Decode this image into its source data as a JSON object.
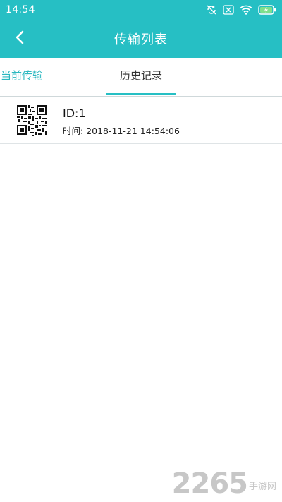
{
  "status_bar": {
    "time": "14:54",
    "icons": [
      "no-sync-icon",
      "sim-blocked-icon",
      "wifi-icon",
      "battery-charging-icon"
    ]
  },
  "header": {
    "back_icon": "chevron-left-icon",
    "title": "传输列表"
  },
  "tabs": [
    {
      "label": "当前传输",
      "active": false
    },
    {
      "label": "历史记录",
      "active": true
    }
  ],
  "records": [
    {
      "thumbnail": "qr-code-icon",
      "id_text": "ID:1",
      "time_text": "时间: 2018-11-21 14:54:06"
    }
  ],
  "watermark": {
    "number": "2265",
    "text": "手游网"
  },
  "colors": {
    "primary": "#26bfc4",
    "tab_inactive": "#2bb8c0",
    "tab_active": "#333333",
    "watermark": "#c7c7c7"
  }
}
